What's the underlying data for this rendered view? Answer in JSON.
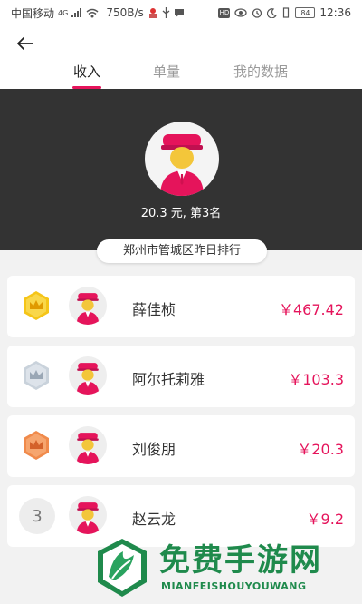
{
  "status_bar": {
    "carrier": "中国移动",
    "network": "4G",
    "speed": "750B/s",
    "battery": "84",
    "hd": "HD",
    "time": "12:36"
  },
  "header": {
    "tabs": [
      "收入",
      "单量",
      "我的数据"
    ],
    "active_tab": 0
  },
  "hero": {
    "summary": "20.3 元, 第3名",
    "ranking_label": "郑州市管城区昨日排行"
  },
  "ranking": [
    {
      "rank": "1",
      "medal": "gold-crown",
      "name": "薛佳桢",
      "amount": "￥467.42"
    },
    {
      "rank": "2",
      "medal": "silver-crown",
      "name": "阿尔托莉雅",
      "amount": "￥103.3"
    },
    {
      "rank": "3",
      "medal": "bronze-crown",
      "name": "刘俊朋",
      "amount": "￥20.3"
    },
    {
      "rank": "3",
      "medal": "number",
      "name": "赵云龙",
      "amount": "￥9.2"
    }
  ],
  "watermark": {
    "title": "免费手游网",
    "subtitle": "MIANFEISHOUYOUWANG"
  },
  "colors": {
    "accent": "#e5145b",
    "hero_bg": "#333333",
    "watermark": "#1f8a4c"
  }
}
